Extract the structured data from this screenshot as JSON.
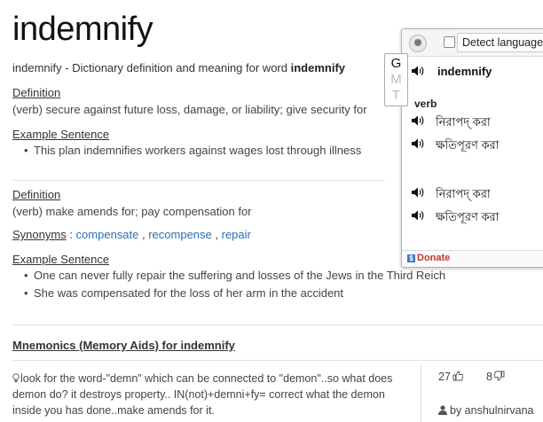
{
  "word": "indemnify",
  "intro": {
    "prefix": "indemnify - Dictionary definition and meaning for word ",
    "word_bold": "indemnify"
  },
  "sense1": {
    "definition_label": "Definition",
    "definition": "(verb) secure against future loss, damage, or liability; give security for",
    "example_label": "Example Sentence",
    "examples": [
      "This plan indemnifies workers against wages lost through illness"
    ]
  },
  "sense2": {
    "definition_label": "Definition",
    "definition": "(verb) make amends for; pay compensation for",
    "synonyms_label": "Synonyms",
    "synonyms_sep": " : ",
    "synonyms": [
      "compensate",
      "recompense",
      "repair"
    ],
    "example_label": "Example Sentence",
    "examples": [
      "One can never fully repair the suffering and losses of the Jews in the Third Reich",
      "She was compensated for the loss of her arm in the accident"
    ]
  },
  "mnemonics": {
    "heading": "Mnemonics (Memory Aids) for indemnify",
    "text": "look for the word-\"demn\" which can be connected to \"demon\"..so what does demon do? it destroys property.. IN(not)+demni+fy= correct what the demon inside you has done..make amends for it.",
    "upvotes": "27",
    "downvotes": "8",
    "author": "by anshulnirvana"
  },
  "popup": {
    "detect_label": "Detect language",
    "gmt": [
      "G",
      "M",
      "T"
    ],
    "headword": "indemnify",
    "pos": "verb",
    "translations": [
      "নিরাপদ্ করা",
      "ক্ষতিপূরণ করা",
      "নিরাপদ্ করা",
      "ক্ষতিপূরণ করা"
    ],
    "donate": "Donate"
  },
  "colors": {
    "link": "#2a6fb5",
    "donate": "#c0392b"
  },
  "icons": [
    "speaker-icon",
    "thumbs-up-icon",
    "thumbs-down-icon",
    "lightbulb-icon",
    "user-icon",
    "globe-icon"
  ]
}
